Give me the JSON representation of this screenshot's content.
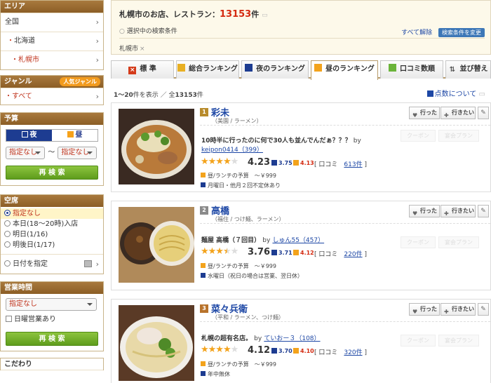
{
  "sidebar": {
    "area": {
      "header": "エリア",
      "items": [
        "全国",
        "北海道",
        "札幌市"
      ]
    },
    "genre": {
      "header": "ジャンル",
      "badge": "人気ジャンル",
      "items": [
        "すべて"
      ]
    },
    "budget": {
      "header": "予算",
      "night_label": "夜",
      "lunch_label": "昼",
      "min_value": "指定なし",
      "separator": "～",
      "max_value": "指定なし",
      "search_label": "再 検 索"
    },
    "vacancy": {
      "header": "空席",
      "options": [
        "指定なし",
        "本日(18～20時)入店",
        "明日(1/16)",
        "明後日(1/17)"
      ],
      "date_option": "日付を指定"
    },
    "hours": {
      "header": "営業時間",
      "select_value": "指定なし",
      "sunday_label": "日曜営業あり",
      "search_label": "再 検 索"
    },
    "kodawari": {
      "header": "こだわり"
    }
  },
  "header": {
    "title_prefix": "札幌市のお店、レストラン：",
    "count": "13153",
    "count_suffix": "件",
    "conditions_label": "選択中の検索条件",
    "clear_all": "すべて解除",
    "change_btn": "検索条件を変更",
    "tag": "札幌市",
    "tag_remove": "×"
  },
  "tabs": [
    "標 準",
    "総合ランキング",
    "夜のランキング",
    "昼のランキング",
    "口コミ数順",
    "並び替え"
  ],
  "list_meta": {
    "range": "1～20",
    "shown_suffix": "件を表示 ／ 全",
    "total": "13153",
    "total_suffix": "件",
    "points_help": "点数について"
  },
  "restaurants": [
    {
      "rank": "1",
      "name": "彩未",
      "area": "（美園 / ラーメン）",
      "review_title": "10時半に行ったのに何で30人も並んでんだぁ？？？",
      "review_by": "by",
      "review_user": "keipon0414（399）",
      "score": "4.23",
      "night_score": "3.75",
      "lunch_score": "4.13",
      "kuchikomi_label": "口コミ",
      "kuchikomi_count": "613件",
      "budget_label": "昼/ランチの予算",
      "budget_value": "～￥999",
      "holiday": "月曜日・他月２回不定休あり",
      "star_level": 4
    },
    {
      "rank": "2",
      "name": "高橋",
      "area": "（福住 / つけ麺、ラーメン）",
      "review_title": "麺屋 高橋（７回目）",
      "review_by": "by",
      "review_user": "しゅん55（457）",
      "score": "3.76",
      "night_score": "3.71",
      "lunch_score": "4.12",
      "kuchikomi_label": "口コミ",
      "kuchikomi_count": "220件",
      "budget_label": "昼/ランチの予算",
      "budget_value": "～￥999",
      "holiday": "水曜日（祝日の場合は営業、翌日休）",
      "star_level": 3.5
    },
    {
      "rank": "3",
      "name": "菜々兵衛",
      "area": "（平和 / ラーメン、つけ麺）",
      "review_title": "札幌の超有名店。",
      "review_by": "by",
      "review_user": "ていおー３（108）",
      "score": "4.12",
      "night_score": "3.70",
      "lunch_score": "4.10",
      "kuchikomi_label": "口コミ",
      "kuchikomi_count": "320件",
      "budget_label": "昼/ランチの予算",
      "budget_value": "～￥999",
      "holiday": "年中無休",
      "star_level": 4
    }
  ],
  "card_buttons": {
    "went": "行った",
    "want": "行きたい"
  },
  "ghost_buttons": [
    "クーポン",
    "宴会プラン"
  ],
  "colors": {
    "brand_brown": "#8c5e26",
    "count_red": "#d42a10",
    "link_blue": "#1d47a5",
    "star_orange": "#f3a31c",
    "green_button": "#5e9c1c"
  }
}
